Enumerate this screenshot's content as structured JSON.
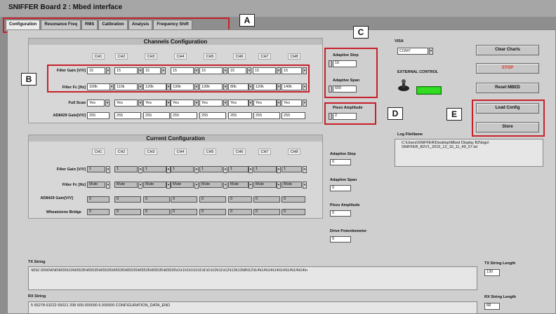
{
  "window": {
    "title": "SNIFFER Board 2 : Mbed interface"
  },
  "tabs": [
    "Configuration",
    "Resonance Freq",
    "RMS",
    "Calibration",
    "Analysis",
    "Frequency Shift"
  ],
  "channels": [
    "CH1",
    "CH2",
    "CH3",
    "CH4",
    "CH5",
    "CH6",
    "CH7",
    "CH8"
  ],
  "channels_config": {
    "title": "Channels Configuration",
    "rows": [
      {
        "label": "Filter Gain [V/V]",
        "values": [
          "15",
          "15",
          "15",
          "15",
          "15",
          "15",
          "15",
          "15"
        ]
      },
      {
        "label": "Filter Fc [Hz]",
        "values": [
          "100k",
          "110k",
          "120k",
          "130k",
          "130k",
          "80k",
          "120k",
          "140k"
        ]
      },
      {
        "label": "Full Scan",
        "values": [
          "Yes",
          "Yes",
          "Yes",
          "Yes",
          "Yes",
          "Yes",
          "Yes",
          "Yes"
        ]
      }
    ],
    "ad_label": "AD8429 Gain[V/V]",
    "ad_values": [
      "255",
      "255",
      "255",
      "255",
      "255",
      "255",
      "255",
      "255"
    ],
    "adaptive_step_label": "Adaptive Step",
    "adaptive_step_value": "10",
    "adaptive_span_label": "Adaptive Span",
    "adaptive_span_value": "600",
    "piezo_label": "Piezo Amplitude",
    "piezo_value": "2"
  },
  "current_config": {
    "title": "Current Configuration",
    "gain_label": "Filter Gain [V/V]",
    "gain_values": [
      "1",
      "1",
      "1",
      "1",
      "1",
      "1",
      "1",
      "1"
    ],
    "fc_label": "Filter Fc [Hz]",
    "fc_values": [
      "Mute",
      "Mute",
      "Mute",
      "Mute",
      "Mute",
      "Mute",
      "Mute",
      "Mute"
    ],
    "ad_label": "AD8429 Gain[V/V]",
    "ad_values": [
      "0",
      "0",
      "0",
      "0",
      "0",
      "0",
      "0",
      "0"
    ],
    "wb_label": "Wheatstone Bridge",
    "wb_values": [
      "0",
      "0",
      "0",
      "0",
      "0",
      "0",
      "0",
      "0"
    ],
    "adaptive_step_label": "Adaptive Step",
    "adaptive_step_value": "0",
    "adaptive_span_label": "Adaptive Span",
    "adaptive_span_value": "0",
    "piezo_label": "Piezo Amplitude",
    "piezo_value": "0",
    "drive_label": "Drive Potentiometer",
    "drive_value": "0"
  },
  "visa": {
    "label": "VISA",
    "value": "COM7"
  },
  "external_control": {
    "label": "EXTERNAL CONTROL"
  },
  "buttons": {
    "clear_charts": "Clear Charts",
    "stop": "STOP",
    "reset_mbed": "Reset MBED",
    "load_config": "Load Config",
    "store": "Store"
  },
  "log": {
    "label": "Log FileName",
    "path_line1": "C:\\Users\\SNIFFER\\Desktop\\Mbed Display B2\\logs\\",
    "path_line2": "SNIFFER_B2V1_2015_12_10_11_49_57.txt"
  },
  "tx": {
    "label": "TX String",
    "value": "\\t0\\t2.00\\t0\\t0\\t0\\t600\\t10\\t65535\\t65535\\t65535\\t65535\\t65535\\t65535\\t65535\\t65535\\t1\\t1\\t1\\t1\\t1\\t1\\t1\\t1\\t10\\t11\\t12\\t13\\t13\\t8\\t12\\t14\\t14\\t14\\t14\\t14\\t14\\t14\\t14\\n",
    "length_label": "TX String Length",
    "length_value": "130"
  },
  "rx": {
    "label": "RX String",
    "value": "5 65278 63222 65021 208 600.000000 6.000000 CONFIGURATION_DATA_END",
    "length_label": "RX String Length",
    "length_value": "68"
  },
  "annotations": {
    "a": "A",
    "b": "B",
    "c": "C",
    "d": "D",
    "e": "E"
  },
  "colors": {
    "annotation": "#c8202a",
    "led": "#33dd22",
    "stop_text": "#e0301e"
  }
}
